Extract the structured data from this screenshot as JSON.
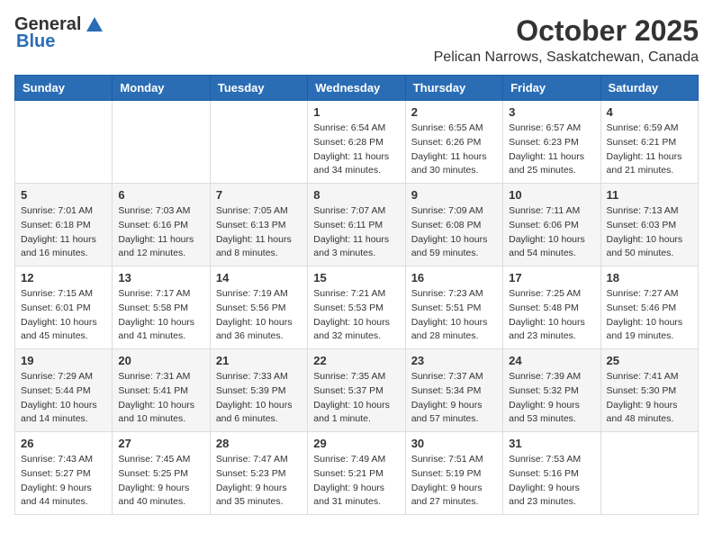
{
  "logo": {
    "general": "General",
    "blue": "Blue"
  },
  "title": "October 2025",
  "location": "Pelican Narrows, Saskatchewan, Canada",
  "days_of_week": [
    "Sunday",
    "Monday",
    "Tuesday",
    "Wednesday",
    "Thursday",
    "Friday",
    "Saturday"
  ],
  "weeks": [
    {
      "days": [
        {
          "num": "",
          "info": ""
        },
        {
          "num": "",
          "info": ""
        },
        {
          "num": "",
          "info": ""
        },
        {
          "num": "1",
          "info": "Sunrise: 6:54 AM\nSunset: 6:28 PM\nDaylight: 11 hours\nand 34 minutes."
        },
        {
          "num": "2",
          "info": "Sunrise: 6:55 AM\nSunset: 6:26 PM\nDaylight: 11 hours\nand 30 minutes."
        },
        {
          "num": "3",
          "info": "Sunrise: 6:57 AM\nSunset: 6:23 PM\nDaylight: 11 hours\nand 25 minutes."
        },
        {
          "num": "4",
          "info": "Sunrise: 6:59 AM\nSunset: 6:21 PM\nDaylight: 11 hours\nand 21 minutes."
        }
      ]
    },
    {
      "days": [
        {
          "num": "5",
          "info": "Sunrise: 7:01 AM\nSunset: 6:18 PM\nDaylight: 11 hours\nand 16 minutes."
        },
        {
          "num": "6",
          "info": "Sunrise: 7:03 AM\nSunset: 6:16 PM\nDaylight: 11 hours\nand 12 minutes."
        },
        {
          "num": "7",
          "info": "Sunrise: 7:05 AM\nSunset: 6:13 PM\nDaylight: 11 hours\nand 8 minutes."
        },
        {
          "num": "8",
          "info": "Sunrise: 7:07 AM\nSunset: 6:11 PM\nDaylight: 11 hours\nand 3 minutes."
        },
        {
          "num": "9",
          "info": "Sunrise: 7:09 AM\nSunset: 6:08 PM\nDaylight: 10 hours\nand 59 minutes."
        },
        {
          "num": "10",
          "info": "Sunrise: 7:11 AM\nSunset: 6:06 PM\nDaylight: 10 hours\nand 54 minutes."
        },
        {
          "num": "11",
          "info": "Sunrise: 7:13 AM\nSunset: 6:03 PM\nDaylight: 10 hours\nand 50 minutes."
        }
      ]
    },
    {
      "days": [
        {
          "num": "12",
          "info": "Sunrise: 7:15 AM\nSunset: 6:01 PM\nDaylight: 10 hours\nand 45 minutes."
        },
        {
          "num": "13",
          "info": "Sunrise: 7:17 AM\nSunset: 5:58 PM\nDaylight: 10 hours\nand 41 minutes."
        },
        {
          "num": "14",
          "info": "Sunrise: 7:19 AM\nSunset: 5:56 PM\nDaylight: 10 hours\nand 36 minutes."
        },
        {
          "num": "15",
          "info": "Sunrise: 7:21 AM\nSunset: 5:53 PM\nDaylight: 10 hours\nand 32 minutes."
        },
        {
          "num": "16",
          "info": "Sunrise: 7:23 AM\nSunset: 5:51 PM\nDaylight: 10 hours\nand 28 minutes."
        },
        {
          "num": "17",
          "info": "Sunrise: 7:25 AM\nSunset: 5:48 PM\nDaylight: 10 hours\nand 23 minutes."
        },
        {
          "num": "18",
          "info": "Sunrise: 7:27 AM\nSunset: 5:46 PM\nDaylight: 10 hours\nand 19 minutes."
        }
      ]
    },
    {
      "days": [
        {
          "num": "19",
          "info": "Sunrise: 7:29 AM\nSunset: 5:44 PM\nDaylight: 10 hours\nand 14 minutes."
        },
        {
          "num": "20",
          "info": "Sunrise: 7:31 AM\nSunset: 5:41 PM\nDaylight: 10 hours\nand 10 minutes."
        },
        {
          "num": "21",
          "info": "Sunrise: 7:33 AM\nSunset: 5:39 PM\nDaylight: 10 hours\nand 6 minutes."
        },
        {
          "num": "22",
          "info": "Sunrise: 7:35 AM\nSunset: 5:37 PM\nDaylight: 10 hours\nand 1 minute."
        },
        {
          "num": "23",
          "info": "Sunrise: 7:37 AM\nSunset: 5:34 PM\nDaylight: 9 hours\nand 57 minutes."
        },
        {
          "num": "24",
          "info": "Sunrise: 7:39 AM\nSunset: 5:32 PM\nDaylight: 9 hours\nand 53 minutes."
        },
        {
          "num": "25",
          "info": "Sunrise: 7:41 AM\nSunset: 5:30 PM\nDaylight: 9 hours\nand 48 minutes."
        }
      ]
    },
    {
      "days": [
        {
          "num": "26",
          "info": "Sunrise: 7:43 AM\nSunset: 5:27 PM\nDaylight: 9 hours\nand 44 minutes."
        },
        {
          "num": "27",
          "info": "Sunrise: 7:45 AM\nSunset: 5:25 PM\nDaylight: 9 hours\nand 40 minutes."
        },
        {
          "num": "28",
          "info": "Sunrise: 7:47 AM\nSunset: 5:23 PM\nDaylight: 9 hours\nand 35 minutes."
        },
        {
          "num": "29",
          "info": "Sunrise: 7:49 AM\nSunset: 5:21 PM\nDaylight: 9 hours\nand 31 minutes."
        },
        {
          "num": "30",
          "info": "Sunrise: 7:51 AM\nSunset: 5:19 PM\nDaylight: 9 hours\nand 27 minutes."
        },
        {
          "num": "31",
          "info": "Sunrise: 7:53 AM\nSunset: 5:16 PM\nDaylight: 9 hours\nand 23 minutes."
        },
        {
          "num": "",
          "info": ""
        }
      ]
    }
  ]
}
